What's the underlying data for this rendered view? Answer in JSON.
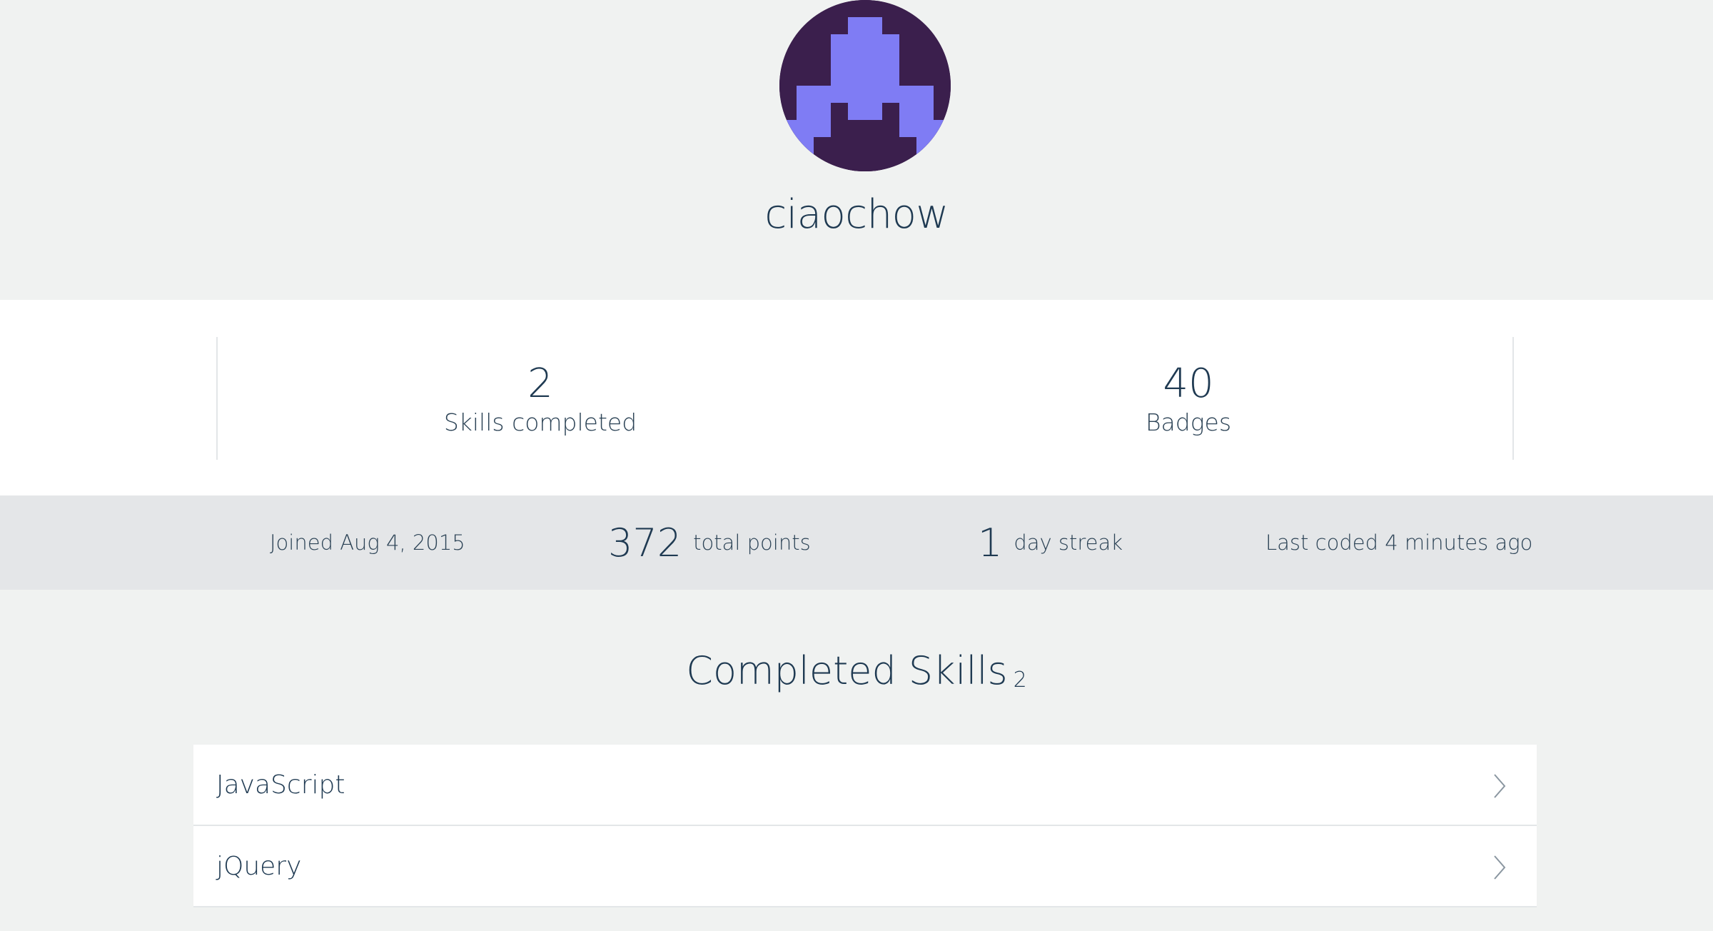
{
  "profile": {
    "username": "ciaochow",
    "avatar_icon": "pixel-invader-avatar",
    "avatar_colors": {
      "background": "#3b1f4d",
      "figure": "#7f7cf4"
    }
  },
  "stats": {
    "skills_count": "2",
    "skills_label": "Skills completed",
    "badges_count": "40",
    "badges_label": "Badges"
  },
  "meta": {
    "joined": "Joined Aug 4, 2015",
    "points_value": "372",
    "points_label": "total points",
    "streak_value": "1",
    "streak_label": "day streak",
    "last_coded": "Last coded 4 minutes ago"
  },
  "completed_skills": {
    "title": "Completed Skills",
    "count": "2",
    "items": [
      {
        "name": "JavaScript",
        "icon": "chevron-right-icon"
      },
      {
        "name": "jQuery",
        "icon": "chevron-right-icon"
      }
    ]
  },
  "colors": {
    "text_primary": "#1f3a52",
    "page_background": "#f0f2f1",
    "band_background": "#e4e6e8",
    "card_background": "#ffffff"
  }
}
